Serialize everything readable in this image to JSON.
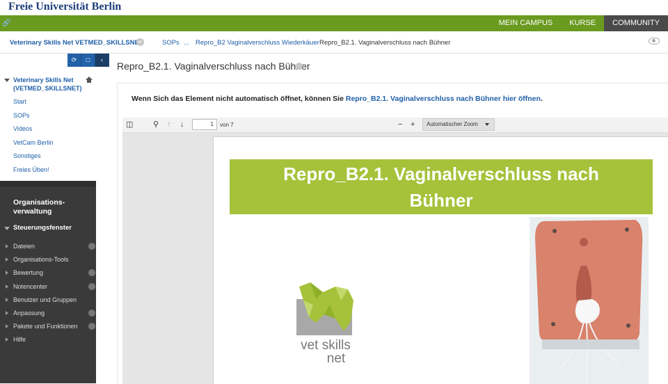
{
  "header": {
    "university": "Freie Universität Berlin",
    "nav": [
      "MEIN CAMPUS",
      "KURSE",
      "COMMUNITY"
    ],
    "nav_active": "COMMUNITY"
  },
  "breadcrumb": {
    "course": "Veterinary Skills Net VETMED_SKILLSNET",
    "items": [
      "SOPs",
      "...",
      "Repro_B2 Vaginalverschluss Wiederkäuer"
    ],
    "current": "Repro_B2.1. Vaginalverschluss nach Bühner"
  },
  "sidebar": {
    "course_title_line1": "Veterinary Skills Net",
    "course_title_line2": "(VETMED_SKILLSNET)",
    "links": [
      "Start",
      "SOPs",
      "Videos",
      "VetCam Berlin",
      "Sonstiges",
      "Freies Üben!"
    ],
    "org_title_line1": "Organisations-",
    "org_title_line2": "verwaltung",
    "control_panel_title": "Steuerungsfenster",
    "control_panel_items": [
      {
        "label": "Dateien",
        "has_plus": true
      },
      {
        "label": "Organisations-Tools",
        "has_plus": false
      },
      {
        "label": "Bewertung",
        "has_plus": true
      },
      {
        "label": "Notencenter",
        "has_plus": true
      },
      {
        "label": "Benutzer und Gruppen",
        "has_plus": false
      },
      {
        "label": "Anpassung",
        "has_plus": true
      },
      {
        "label": "Pakete und Funktionen",
        "has_plus": true
      },
      {
        "label": "Hilfe",
        "has_plus": false
      }
    ]
  },
  "content": {
    "title": "Repro_B2.1. Vaginalverschluss nach Bühner",
    "open_message_prefix": "Wenn Sich das Element nicht automatisch öffnet, können Sie",
    "open_message_link": "Repro_B2.1. Vaginalverschluss nach Bühner hier öffnen",
    "open_message_suffix": "."
  },
  "pdf_viewer": {
    "page_number": "1",
    "page_count_label": "von 7",
    "zoom": "Automatischer Zoom",
    "banner_line1": "Repro_B2.1. Vaginalverschluss nach",
    "banner_line2": "Bühner",
    "logo_line1": "vet skills",
    "logo_line2": "net"
  },
  "colors": {
    "green_bar": "#6a9a1f",
    "link_blue": "#1f5fa8",
    "banner_green": "#a5c23a",
    "dark_panel": "#3a3a3a"
  }
}
